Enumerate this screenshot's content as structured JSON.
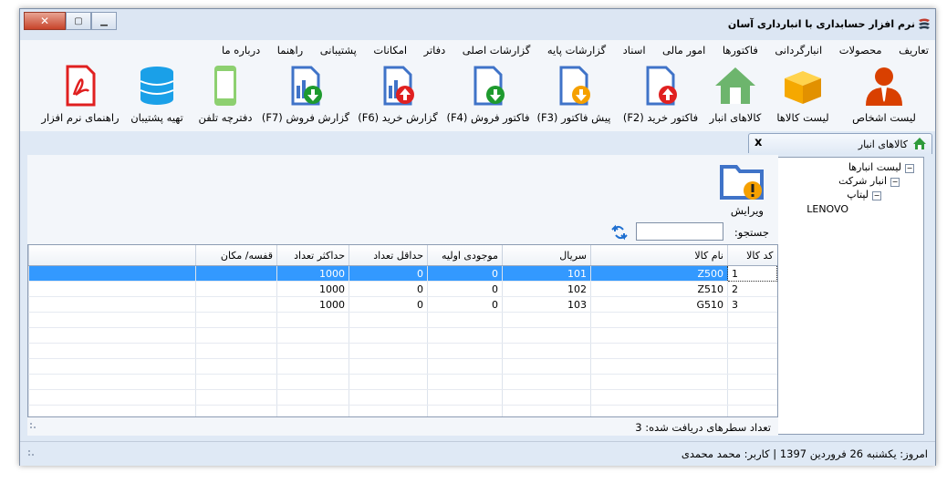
{
  "window": {
    "title": "نرم افزار حسابداری با انبارداری آسان",
    "minimize": "▁",
    "maximize": "▢",
    "close": "✕"
  },
  "menu": [
    "تعاریف",
    "محصولات",
    "انبارگردانی",
    "فاکتورها",
    "امور مالی",
    "اسناد",
    "گزارشات پایه",
    "گزارشات اصلی",
    "دفاتر",
    "امکانات",
    "پشتیبانی",
    "راهنما",
    "درباره ما"
  ],
  "ribbon": [
    {
      "label": "لیست اشخاص",
      "icon": "person-icon"
    },
    {
      "label": "لیست کالاها",
      "icon": "box-icon"
    },
    {
      "label": "کالاهای انبار",
      "icon": "warehouse-icon"
    },
    {
      "label": "فاکتور خرید (F2)",
      "icon": "purchase-invoice-icon"
    },
    {
      "label": "پیش فاکتور (F3)",
      "icon": "pre-invoice-icon"
    },
    {
      "label": "فاکتور فروش (F4)",
      "icon": "sales-invoice-icon"
    },
    {
      "label": "گزارش خرید (F6)",
      "icon": "purchase-report-icon"
    },
    {
      "label": "گزارش فروش (F7)",
      "icon": "sales-report-icon"
    },
    {
      "label": "دفترچه تلفن",
      "icon": "phone-icon"
    },
    {
      "label": "تهیه پشتیبان",
      "icon": "database-icon"
    },
    {
      "label": "راهنمای نرم افزار",
      "icon": "pdf-icon"
    }
  ],
  "tab": {
    "label": "کالاهای انبار",
    "close": "x"
  },
  "tree": {
    "root": "لیست انبارها",
    "child": "انبار شرکت",
    "grandchild": "لپتاپ",
    "leaf": "LENOVO",
    "expander": "−"
  },
  "toolbar": {
    "edit_label": "ویرایش"
  },
  "search": {
    "label": "جستجو:",
    "value": ""
  },
  "grid": {
    "columns": [
      "کد کالا",
      "نام کالا",
      "سریال",
      "موجودی اولیه",
      "حداقل تعداد",
      "حداکثر تعداد",
      "قفسه/ مکان"
    ],
    "rows": [
      [
        "1",
        "Z500",
        "101",
        "0",
        "0",
        "1000",
        ""
      ],
      [
        "2",
        "Z510",
        "102",
        "0",
        "0",
        "1000",
        ""
      ],
      [
        "3",
        "G510",
        "103",
        "0",
        "0",
        "1000",
        ""
      ]
    ]
  },
  "status": {
    "label": "تعداد سطرهای دریافت شده:",
    "count": "3"
  },
  "footer": {
    "text": "امروز: یکشنبه 26 فروردین 1397  |  کاربر: محمد محمدی"
  },
  "colors": {
    "accent": "#3399ff",
    "blue_icon": "#4a7fd0",
    "red": "#e02020",
    "green": "#1e9a2e",
    "orange": "#f5a000"
  }
}
